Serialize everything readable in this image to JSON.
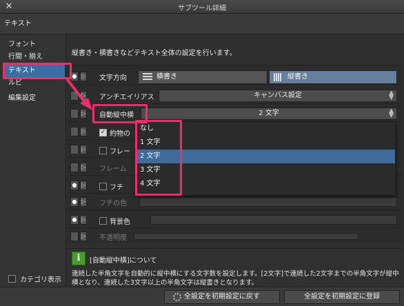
{
  "window": {
    "title": "サブツール詳細",
    "close_icon": "close-icon"
  },
  "header": {
    "subtool_name": "テキスト"
  },
  "sidebar": {
    "items": [
      {
        "label": "フォント"
      },
      {
        "label": "行間・揃え"
      },
      {
        "label": "テキスト",
        "selected": true
      },
      {
        "label": "ルビ"
      },
      {
        "label": "編集設定"
      }
    ],
    "category_display_label": "カテゴリ表示"
  },
  "description": "縦書き・横書きなどテキスト全体の設定を行います。",
  "settings": {
    "direction": {
      "label": "文字方向",
      "horizontal": "横書き",
      "vertical": "縦書き",
      "selected": "縦書き"
    },
    "antialias": {
      "label": "アンチエイリアス",
      "value": "キャンバス設定"
    },
    "auto_tatechuyoko": {
      "label": "自動縦中横",
      "value": "2 文字"
    },
    "row_yakumono": {
      "label": "約物の"
    },
    "row_frame": {
      "label": "フレー"
    },
    "row_frame_color": {
      "label": "フレーム"
    },
    "border": {
      "label": "フチ"
    },
    "border_color": {
      "label": "フチの色"
    },
    "bg_color": {
      "label": "背景色"
    },
    "opacity": {
      "label": "不透明度"
    }
  },
  "dropdown": {
    "options": [
      "なし",
      "1 文字",
      "2 文字",
      "3 文字",
      "4 文字"
    ],
    "selected_index": 2
  },
  "info": {
    "title": "[自動縦中横]について",
    "text": "連続した半角文字を自動的に縦中横にする文字数を設定します。[2文字]で連続した2文字までの半角文字が縦中横となり、連続した3文字以上の半角文字は縦書きとなります。"
  },
  "footer": {
    "reset_button": "全設定を初期設定に戻す",
    "register_button": "全設定を初期設定に登録"
  },
  "colors": {
    "highlight": "#e8306a",
    "selection": "#3e6b9a",
    "info_icon": "#4a9a2e"
  }
}
